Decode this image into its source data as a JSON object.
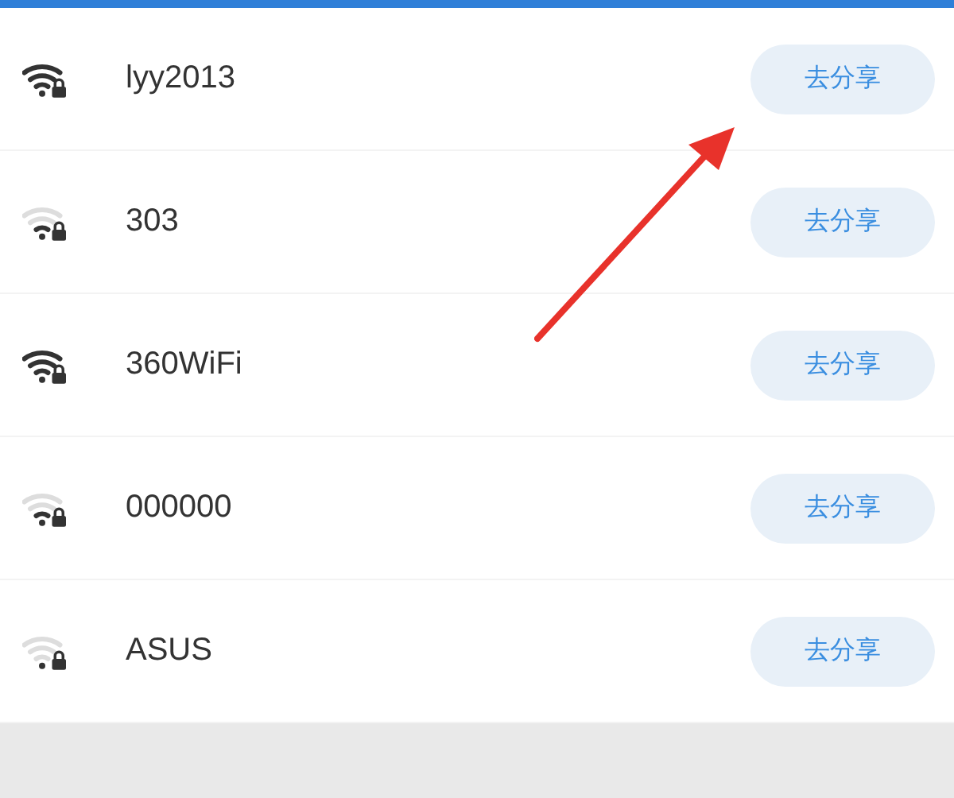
{
  "networks": [
    {
      "name": "lyy2013",
      "kind": "full",
      "button": "去分享"
    },
    {
      "name": "303",
      "kind": "medium",
      "button": "去分享"
    },
    {
      "name": "360WiFi",
      "kind": "full",
      "button": "去分享"
    },
    {
      "name": "000000",
      "kind": "medium",
      "button": "去分享"
    },
    {
      "name": "ASUS",
      "kind": "weak",
      "button": "去分享"
    }
  ]
}
